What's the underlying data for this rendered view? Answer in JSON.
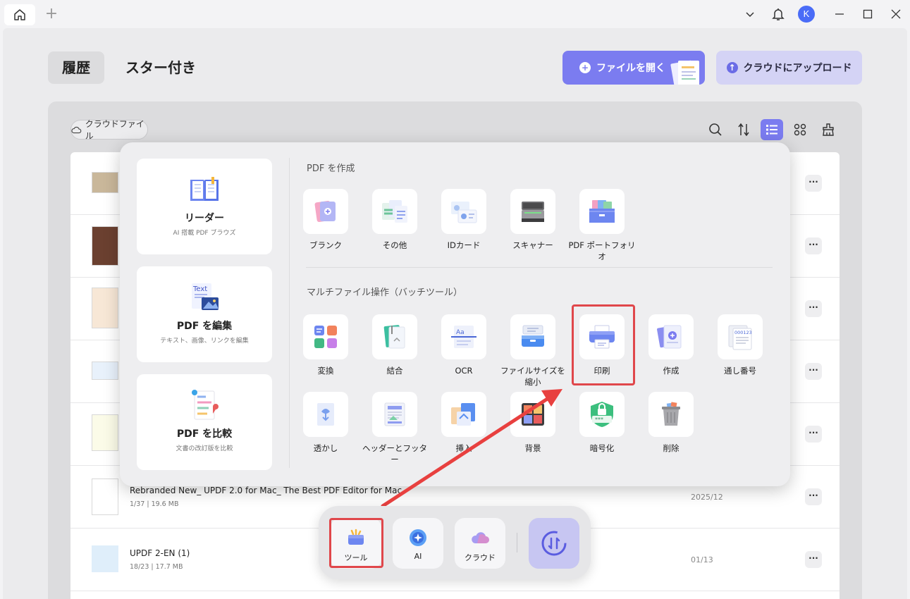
{
  "titlebar": {
    "home_icon": "home-icon",
    "new_tab_symbol": "+",
    "avatar_letter": "K"
  },
  "header": {
    "tab_history": "履歴",
    "tab_starred": "スター付き",
    "open_file": "ファイルを開く",
    "upload_cloud": "クラウドにアップロード"
  },
  "panel": {
    "cloud_files": "クラウドファイル"
  },
  "files": [
    {
      "name": "Rebranded New_ UPDF 2.0 for Mac_ The Best PDF Editor for Mac",
      "meta": "1/37 | 19.6 MB",
      "date": "2025/12"
    },
    {
      "name": "UPDF 2-EN (1)",
      "meta": "18/23 | 17.7 MB",
      "date": "01/13"
    }
  ],
  "more_label": "···",
  "popup": {
    "modes": [
      {
        "title": "リーダー",
        "sub": "AI 搭載 PDF ブラウズ"
      },
      {
        "title": "PDF を編集",
        "sub": "テキスト、画像、リンクを編集"
      },
      {
        "title": "PDF を比較",
        "sub": "文書の改訂版を比較"
      }
    ],
    "edit_icon_text": "Text",
    "create_section": "PDF を作成",
    "create_tools": [
      "ブランク",
      "その他",
      "IDカード",
      "スキャナー",
      "PDF ポートフォリオ"
    ],
    "batch_section": "マルチファイル操作（バッチツール）",
    "batch_tools_row1": [
      "変換",
      "結合",
      "OCR",
      "ファイルサイズを縮小",
      "印刷",
      "作成",
      "通し番号"
    ],
    "batch_tools_row2": [
      "透かし",
      "ヘッダーとフッター",
      "挿入",
      "背景",
      "暗号化",
      "削除"
    ],
    "ocr_icon_text": "Aa",
    "serial_icon_text": "000123",
    "encrypt_icon_text": "***"
  },
  "dock": {
    "tools": "ツール",
    "ai": "AI",
    "cloud": "クラウド"
  },
  "colors": {
    "accent": "#7b7cf0",
    "highlight": "#e0474b"
  }
}
